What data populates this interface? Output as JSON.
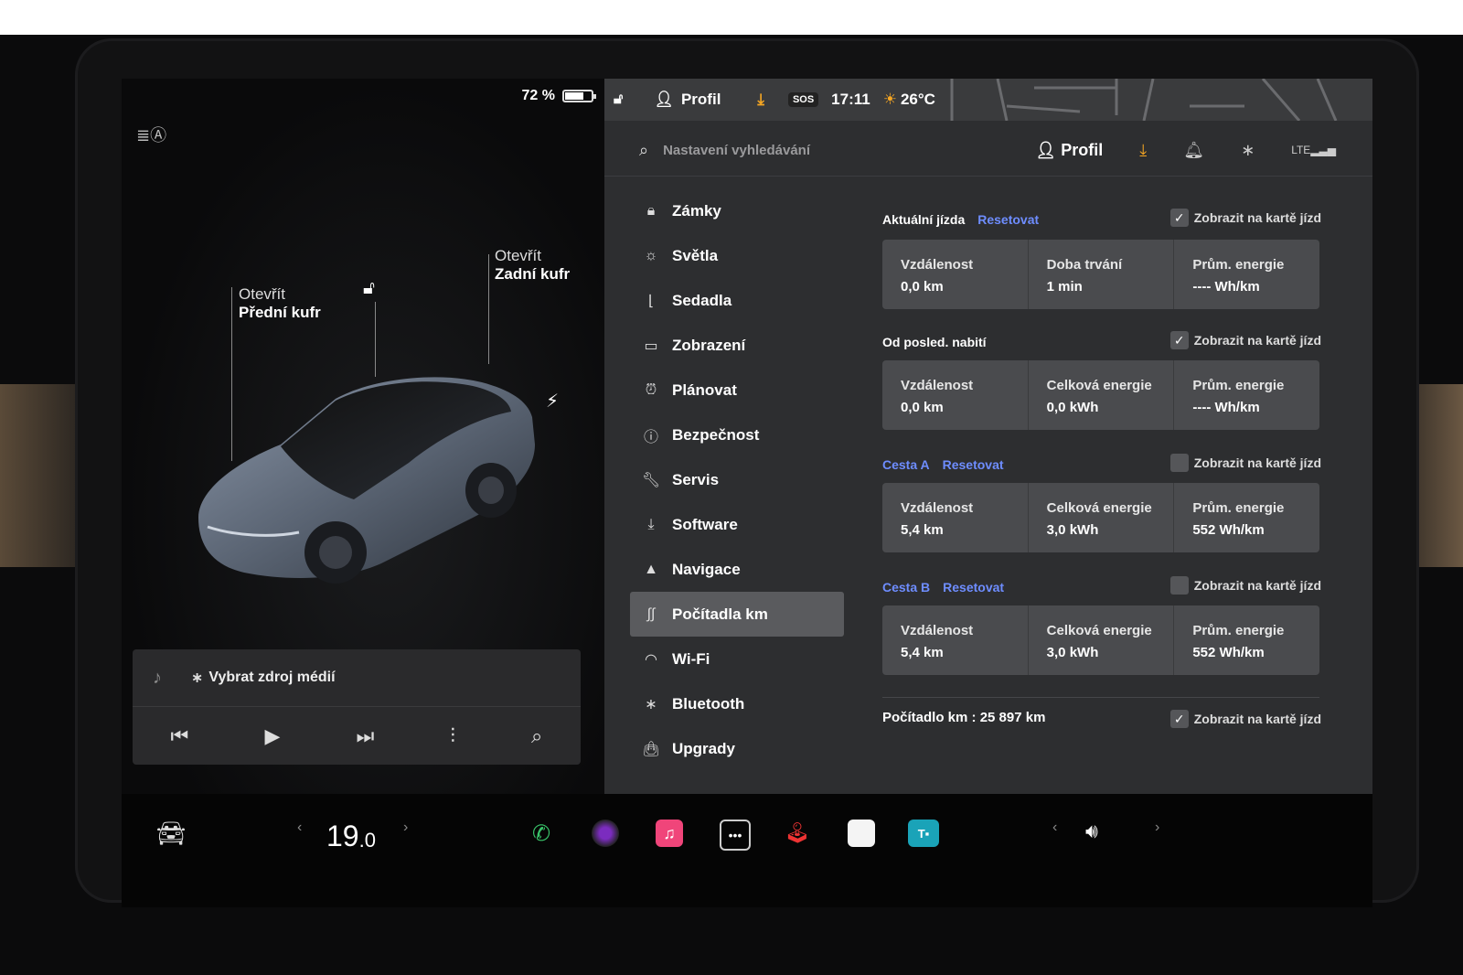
{
  "status": {
    "battery_percent": "72 %",
    "battery_level": 0.72,
    "profile": "Profil",
    "sos": "SOS",
    "time": "17:11",
    "temperature": "26°C"
  },
  "vehicle": {
    "front_trunk_action": "Otevřít",
    "front_trunk_label": "Přední kufr",
    "rear_trunk_action": "Otevřít",
    "rear_trunk_label": "Zadní kufr"
  },
  "media": {
    "source_label": "Vybrat zdroj médií"
  },
  "settings": {
    "search_placeholder": "Nastavení vyhledávání",
    "profile": "Profil",
    "menu": [
      {
        "label": "Zámky",
        "icon": "lock-icon"
      },
      {
        "label": "Světla",
        "icon": "light-icon"
      },
      {
        "label": "Sedadla",
        "icon": "seat-icon"
      },
      {
        "label": "Zobrazení",
        "icon": "display-icon"
      },
      {
        "label": "Plánovat",
        "icon": "alarm-clock-icon"
      },
      {
        "label": "Bezpečnost",
        "icon": "safety-icon"
      },
      {
        "label": "Servis",
        "icon": "wrench-icon"
      },
      {
        "label": "Software",
        "icon": "download-icon"
      },
      {
        "label": "Navigace",
        "icon": "navigation-icon"
      },
      {
        "label": "Počítadla km",
        "icon": "trips-icon",
        "active": true
      },
      {
        "label": "Wi-Fi",
        "icon": "wifi-icon"
      },
      {
        "label": "Bluetooth",
        "icon": "bluetooth-icon"
      },
      {
        "label": "Upgrady",
        "icon": "shopping-bag-icon"
      }
    ]
  },
  "trips": {
    "reset_label": "Resetovat",
    "show_on_card_label": "Zobrazit na kartě jízd",
    "current": {
      "title": "Aktuální jízda",
      "checked": true,
      "stats": [
        {
          "label": "Vzdálenost",
          "value": "0,0 km"
        },
        {
          "label": "Doba trvání",
          "value": "1 min"
        },
        {
          "label": "Prům. energie",
          "value": "---- Wh/km"
        }
      ]
    },
    "since_charge": {
      "title": "Od posled. nabití",
      "checked": true,
      "stats": [
        {
          "label": "Vzdálenost",
          "value": "0,0 km"
        },
        {
          "label": "Celková energie",
          "value": "0,0 kWh"
        },
        {
          "label": "Prům. energie",
          "value": "---- Wh/km"
        }
      ]
    },
    "trip_a": {
      "title": "Cesta A",
      "checked": false,
      "stats": [
        {
          "label": "Vzdálenost",
          "value": "5,4 km"
        },
        {
          "label": "Celková energie",
          "value": "3,0 kWh"
        },
        {
          "label": "Prům. energie",
          "value": "552 Wh/km"
        }
      ]
    },
    "trip_b": {
      "title": "Cesta B",
      "checked": false,
      "stats": [
        {
          "label": "Vzdálenost",
          "value": "5,4 km"
        },
        {
          "label": "Celková energie",
          "value": "3,0 kWh"
        },
        {
          "label": "Prům. energie",
          "value": "552 Wh/km"
        }
      ]
    },
    "odometer_label": "Počítadlo km",
    "odometer_value": "25 897 km",
    "odometer_checked": true
  },
  "climate": {
    "temperature_whole": "19",
    "temperature_decimal": ".0"
  },
  "colors": {
    "accent_blue": "#6e8dff",
    "download_orange": "#f5a623",
    "phone_green": "#39c46a",
    "music_pink": "#f0457a"
  }
}
